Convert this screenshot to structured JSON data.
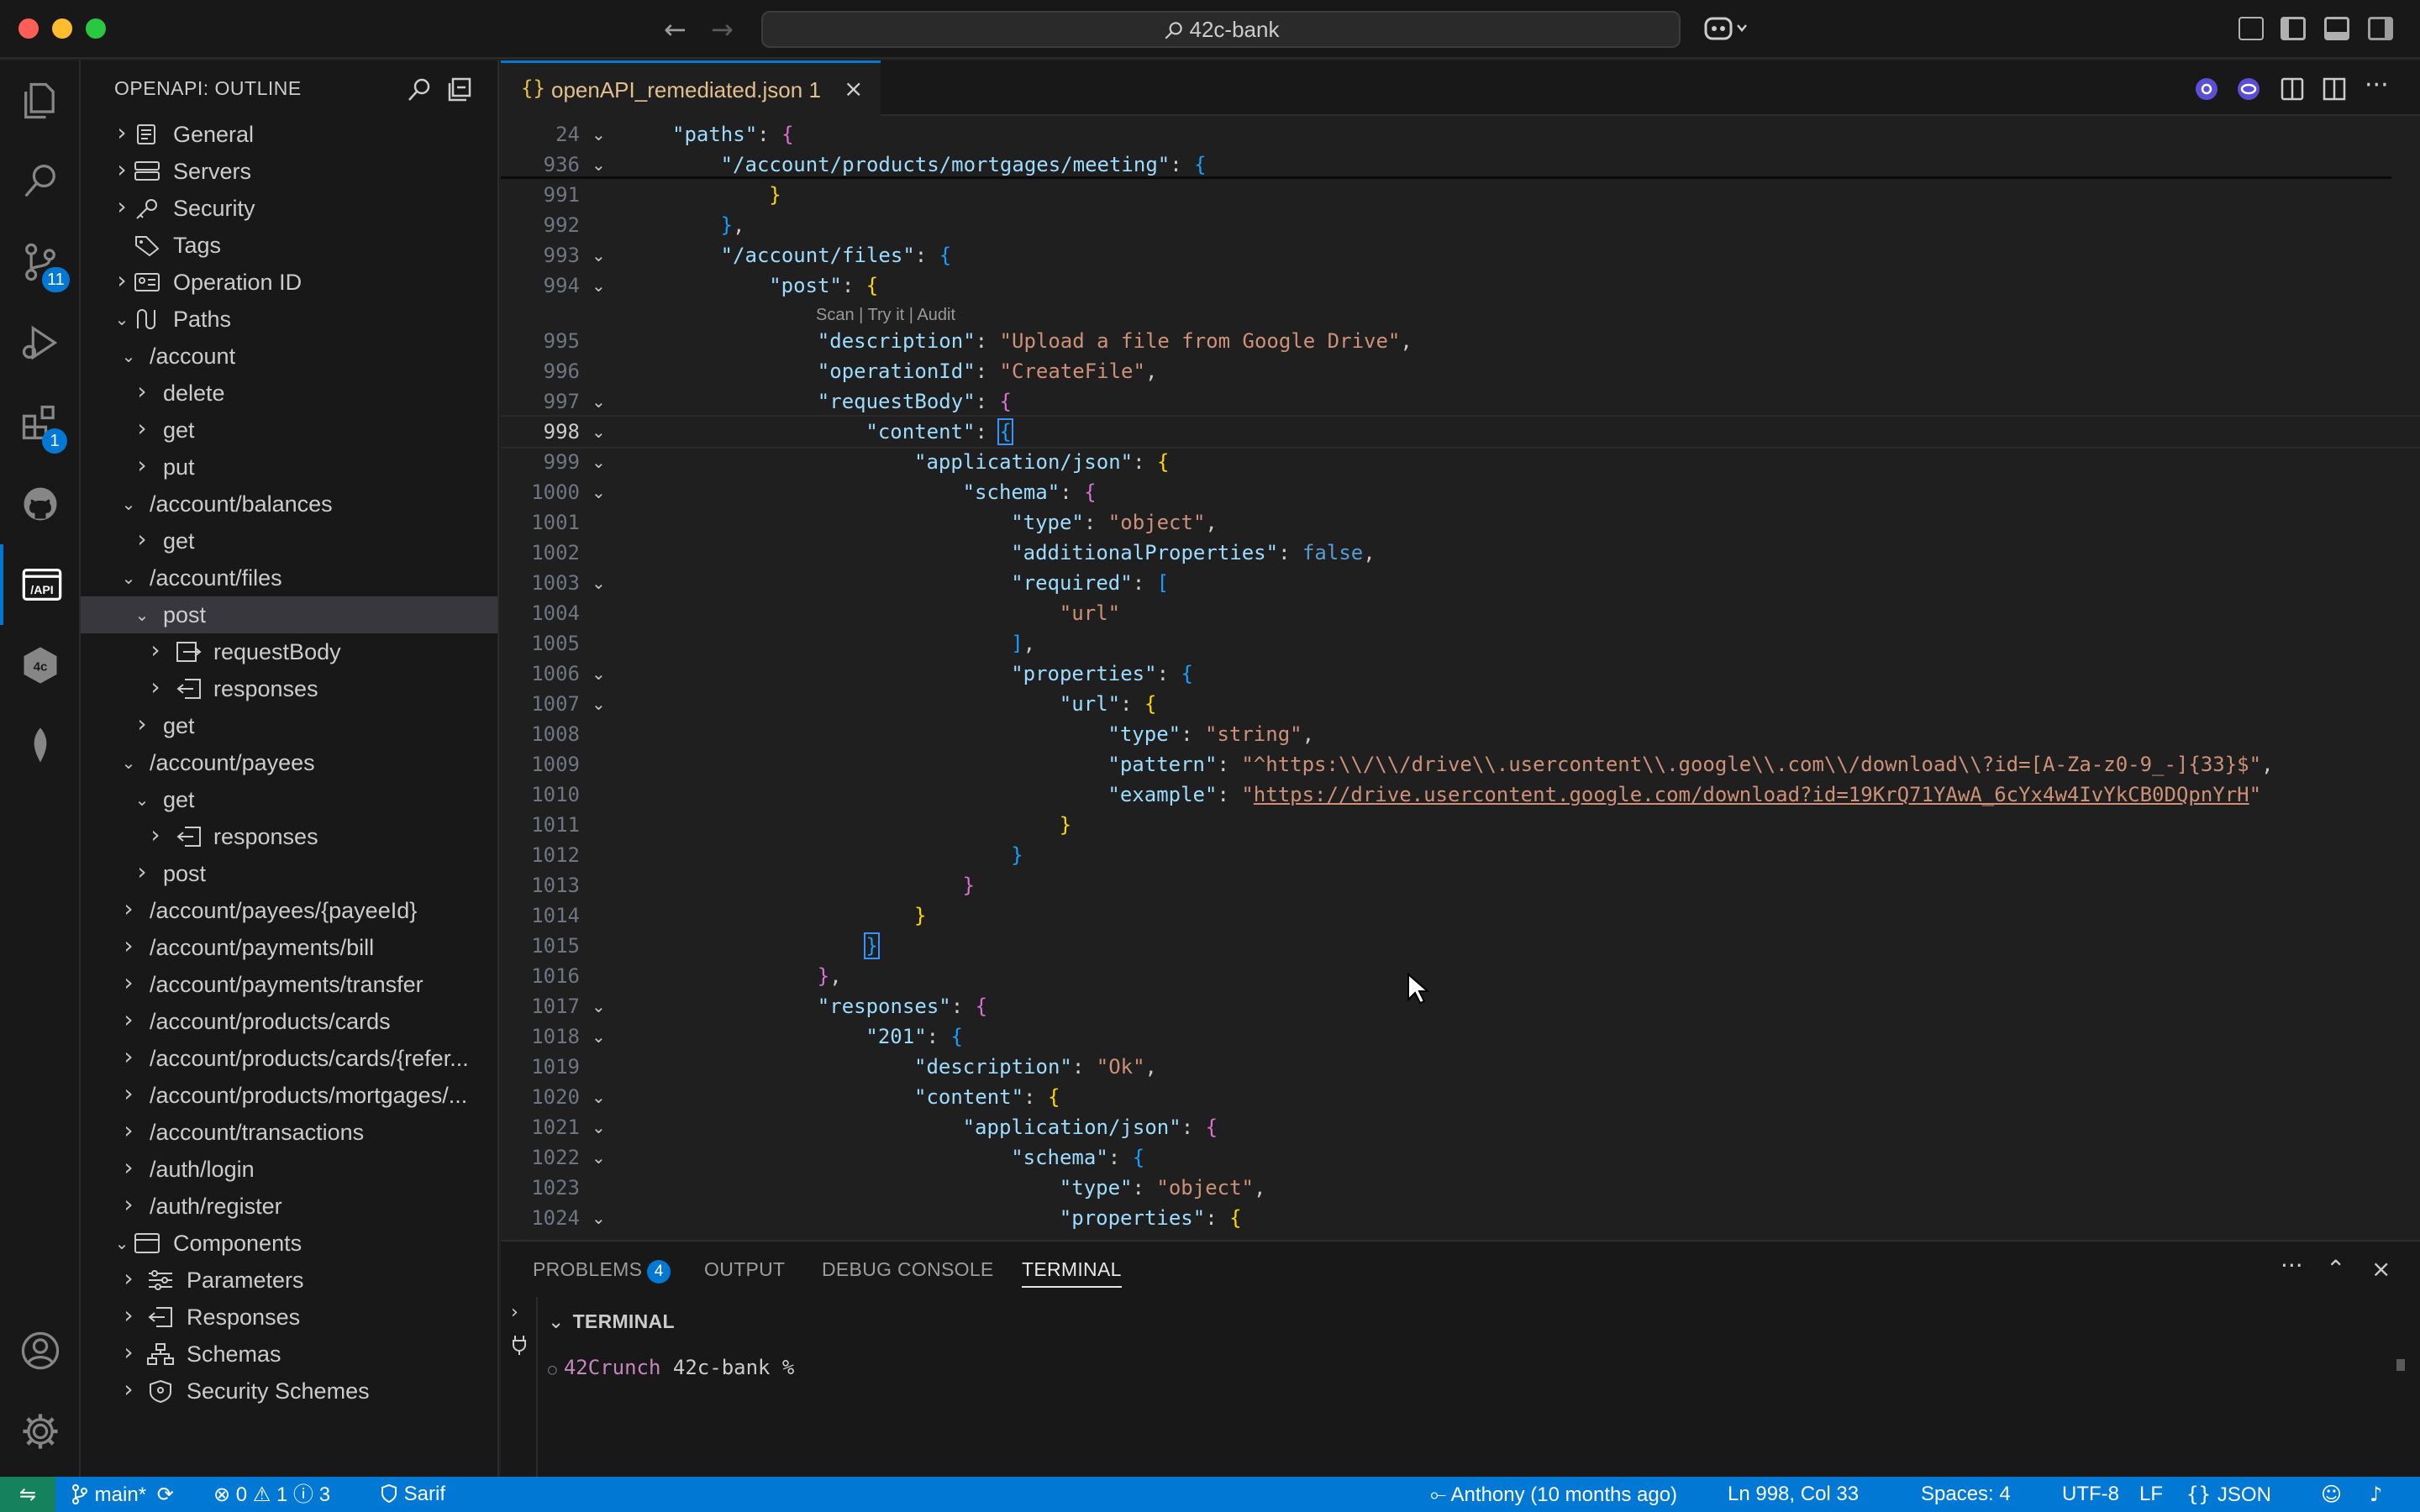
{
  "window": {
    "title": "42c-bank"
  },
  "sidebar": {
    "title": "OPENAPI: OUTLINE",
    "tree": [
      {
        "label": "General",
        "icon": "document-icon",
        "chevron": "right",
        "level": 0
      },
      {
        "label": "Servers",
        "icon": "server-icon",
        "chevron": "right",
        "level": 0
      },
      {
        "label": "Security",
        "icon": "key-icon",
        "chevron": "right",
        "level": 0
      },
      {
        "label": "Tags",
        "icon": "tag-icon",
        "chevron": "none",
        "level": 0
      },
      {
        "label": "Operation ID",
        "icon": "id-card-icon",
        "chevron": "right",
        "level": 0
      },
      {
        "label": "Paths",
        "icon": "paths-icon",
        "chevron": "down",
        "level": 0
      },
      {
        "label": "/account",
        "icon": "",
        "chevron": "down",
        "level": 1
      },
      {
        "label": "delete",
        "icon": "",
        "chevron": "right",
        "level": 2
      },
      {
        "label": "get",
        "icon": "",
        "chevron": "right",
        "level": 2
      },
      {
        "label": "put",
        "icon": "",
        "chevron": "right",
        "level": 2
      },
      {
        "label": "/account/balances",
        "icon": "",
        "chevron": "down",
        "level": 1
      },
      {
        "label": "get",
        "icon": "",
        "chevron": "right",
        "level": 2
      },
      {
        "label": "/account/files",
        "icon": "",
        "chevron": "down",
        "level": 1
      },
      {
        "label": "post",
        "icon": "",
        "chevron": "down",
        "level": 2,
        "selected": true
      },
      {
        "label": "requestBody",
        "icon": "request-body-icon",
        "chevron": "right",
        "level": 3
      },
      {
        "label": "responses",
        "icon": "responses-icon",
        "chevron": "right",
        "level": 3
      },
      {
        "label": "get",
        "icon": "",
        "chevron": "right",
        "level": 2
      },
      {
        "label": "/account/payees",
        "icon": "",
        "chevron": "down",
        "level": 1
      },
      {
        "label": "get",
        "icon": "",
        "chevron": "down",
        "level": 2
      },
      {
        "label": "responses",
        "icon": "responses-icon",
        "chevron": "right",
        "level": 3
      },
      {
        "label": "post",
        "icon": "",
        "chevron": "right",
        "level": 2
      },
      {
        "label": "/account/payees/{payeeId}",
        "icon": "",
        "chevron": "right",
        "level": 1
      },
      {
        "label": "/account/payments/bill",
        "icon": "",
        "chevron": "right",
        "level": 1
      },
      {
        "label": "/account/payments/transfer",
        "icon": "",
        "chevron": "right",
        "level": 1
      },
      {
        "label": "/account/products/cards",
        "icon": "",
        "chevron": "right",
        "level": 1
      },
      {
        "label": "/account/products/cards/{refer...",
        "icon": "",
        "chevron": "right",
        "level": 1
      },
      {
        "label": "/account/products/mortgages/...",
        "icon": "",
        "chevron": "right",
        "level": 1
      },
      {
        "label": "/account/transactions",
        "icon": "",
        "chevron": "right",
        "level": 1
      },
      {
        "label": "/auth/login",
        "icon": "",
        "chevron": "right",
        "level": 1
      },
      {
        "label": "/auth/register",
        "icon": "",
        "chevron": "right",
        "level": 1
      },
      {
        "label": "Components",
        "icon": "package-icon",
        "chevron": "down",
        "level": 0
      },
      {
        "label": "Parameters",
        "icon": "sliders-icon",
        "chevron": "right",
        "level": 1
      },
      {
        "label": "Responses",
        "icon": "responses-icon",
        "chevron": "right",
        "level": 1
      },
      {
        "label": "Schemas",
        "icon": "hierarchy-icon",
        "chevron": "right",
        "level": 1
      },
      {
        "label": "Security Schemes",
        "icon": "shield-icon",
        "chevron": "right",
        "level": 1
      }
    ]
  },
  "activity": {
    "source_control_badge": "11",
    "extensions_badge": "1"
  },
  "editor": {
    "tab": {
      "icon": "{}",
      "label": "openAPI_remediated.json",
      "problems": "1"
    },
    "codelens": "Scan | Try it | Audit",
    "current_line": "998",
    "lines": [
      {
        "n": "24",
        "fold": true,
        "ind": 0,
        "tok": [
          [
            "k",
            "\"paths\""
          ],
          [
            "p",
            ": "
          ],
          [
            "b2",
            "{"
          ]
        ]
      },
      {
        "n": "936",
        "fold": true,
        "ind": 1,
        "tok": [
          [
            "k",
            "\"/account/products/mortgages/meeting\""
          ],
          [
            "p",
            ": "
          ],
          [
            "b3",
            "{"
          ]
        ]
      },
      {
        "n": "991",
        "fold": false,
        "ind": 2,
        "tok": [
          [
            "b1",
            "}"
          ]
        ]
      },
      {
        "n": "992",
        "fold": false,
        "ind": 1,
        "tok": [
          [
            "b3",
            "}"
          ],
          [
            "p",
            ","
          ]
        ]
      },
      {
        "n": "993",
        "fold": true,
        "ind": 1,
        "tok": [
          [
            "k",
            "\"/account/files\""
          ],
          [
            "p",
            ": "
          ],
          [
            "b3",
            "{"
          ]
        ]
      },
      {
        "n": "994",
        "fold": true,
        "ind": 2,
        "tok": [
          [
            "k",
            "\"post\""
          ],
          [
            "p",
            ": "
          ],
          [
            "b1",
            "{"
          ]
        ]
      },
      {
        "n": "995",
        "fold": false,
        "ind": 3,
        "tok": [
          [
            "k",
            "\"description\""
          ],
          [
            "p",
            ": "
          ],
          [
            "s",
            "\"Upload a file from Google Drive\""
          ],
          [
            "p",
            ","
          ]
        ]
      },
      {
        "n": "996",
        "fold": false,
        "ind": 3,
        "tok": [
          [
            "k",
            "\"operationId\""
          ],
          [
            "p",
            ": "
          ],
          [
            "s",
            "\"CreateFile\""
          ],
          [
            "p",
            ","
          ]
        ]
      },
      {
        "n": "997",
        "fold": true,
        "ind": 3,
        "tok": [
          [
            "k",
            "\"requestBody\""
          ],
          [
            "p",
            ": "
          ],
          [
            "b2",
            "{"
          ]
        ]
      },
      {
        "n": "998",
        "fold": true,
        "ind": 4,
        "tok": [
          [
            "k",
            "\"content\""
          ],
          [
            "p",
            ": "
          ],
          [
            "b3m",
            "{"
          ]
        ]
      },
      {
        "n": "999",
        "fold": true,
        "ind": 5,
        "tok": [
          [
            "k",
            "\"application/json\""
          ],
          [
            "p",
            ": "
          ],
          [
            "b1",
            "{"
          ]
        ]
      },
      {
        "n": "1000",
        "fold": true,
        "ind": 6,
        "tok": [
          [
            "k",
            "\"schema\""
          ],
          [
            "p",
            ": "
          ],
          [
            "b2",
            "{"
          ]
        ]
      },
      {
        "n": "1001",
        "fold": false,
        "ind": 7,
        "tok": [
          [
            "k",
            "\"type\""
          ],
          [
            "p",
            ": "
          ],
          [
            "s",
            "\"object\""
          ],
          [
            "p",
            ","
          ]
        ]
      },
      {
        "n": "1002",
        "fold": false,
        "ind": 7,
        "tok": [
          [
            "k",
            "\"additionalProperties\""
          ],
          [
            "p",
            ": "
          ],
          [
            "kw",
            "false"
          ],
          [
            "p",
            ","
          ]
        ]
      },
      {
        "n": "1003",
        "fold": true,
        "ind": 7,
        "tok": [
          [
            "k",
            "\"required\""
          ],
          [
            "p",
            ": "
          ],
          [
            "b3",
            "["
          ]
        ]
      },
      {
        "n": "1004",
        "fold": false,
        "ind": 8,
        "tok": [
          [
            "s",
            "\"url\""
          ]
        ]
      },
      {
        "n": "1005",
        "fold": false,
        "ind": 7,
        "tok": [
          [
            "b3",
            "]"
          ],
          [
            "p",
            ","
          ]
        ]
      },
      {
        "n": "1006",
        "fold": true,
        "ind": 7,
        "tok": [
          [
            "k",
            "\"properties\""
          ],
          [
            "p",
            ": "
          ],
          [
            "b3",
            "{"
          ]
        ]
      },
      {
        "n": "1007",
        "fold": true,
        "ind": 8,
        "tok": [
          [
            "k",
            "\"url\""
          ],
          [
            "p",
            ": "
          ],
          [
            "b1",
            "{"
          ]
        ]
      },
      {
        "n": "1008",
        "fold": false,
        "ind": 9,
        "tok": [
          [
            "k",
            "\"type\""
          ],
          [
            "p",
            ": "
          ],
          [
            "s",
            "\"string\""
          ],
          [
            "p",
            ","
          ]
        ]
      },
      {
        "n": "1009",
        "fold": false,
        "ind": 9,
        "tok": [
          [
            "k",
            "\"pattern\""
          ],
          [
            "p",
            ": "
          ],
          [
            "s",
            "\"^https:\\\\/\\\\/drive\\\\.usercontent\\\\.google\\\\.com\\\\/download\\\\?id=[A-Za-z0-9_-]{33}$\""
          ],
          [
            "p",
            ","
          ]
        ]
      },
      {
        "n": "1010",
        "fold": false,
        "ind": 9,
        "tok": [
          [
            "k",
            "\"example\""
          ],
          [
            "p",
            ": "
          ],
          [
            "s",
            "\""
          ],
          [
            "u",
            "https://drive.usercontent.google.com/download?id=19KrQ71YAwA_6cYx4w4IvYkCB0DQpnYrH"
          ],
          [
            "s",
            "\""
          ]
        ]
      },
      {
        "n": "1011",
        "fold": false,
        "ind": 8,
        "tok": [
          [
            "b1",
            "}"
          ]
        ]
      },
      {
        "n": "1012",
        "fold": false,
        "ind": 7,
        "tok": [
          [
            "b3",
            "}"
          ]
        ]
      },
      {
        "n": "1013",
        "fold": false,
        "ind": 6,
        "tok": [
          [
            "b2",
            "}"
          ]
        ]
      },
      {
        "n": "1014",
        "fold": false,
        "ind": 5,
        "tok": [
          [
            "b1",
            "}"
          ]
        ]
      },
      {
        "n": "1015",
        "fold": false,
        "ind": 4,
        "tok": [
          [
            "b3m",
            "}"
          ]
        ]
      },
      {
        "n": "1016",
        "fold": false,
        "ind": 3,
        "tok": [
          [
            "b2",
            "}"
          ],
          [
            "p",
            ","
          ]
        ]
      },
      {
        "n": "1017",
        "fold": true,
        "ind": 3,
        "tok": [
          [
            "k",
            "\"responses\""
          ],
          [
            "p",
            ": "
          ],
          [
            "b2",
            "{"
          ]
        ]
      },
      {
        "n": "1018",
        "fold": true,
        "ind": 4,
        "tok": [
          [
            "k",
            "\"201\""
          ],
          [
            "p",
            ": "
          ],
          [
            "b3",
            "{"
          ]
        ]
      },
      {
        "n": "1019",
        "fold": false,
        "ind": 5,
        "tok": [
          [
            "k",
            "\"description\""
          ],
          [
            "p",
            ": "
          ],
          [
            "s",
            "\"Ok\""
          ],
          [
            "p",
            ","
          ]
        ]
      },
      {
        "n": "1020",
        "fold": true,
        "ind": 5,
        "tok": [
          [
            "k",
            "\"content\""
          ],
          [
            "p",
            ": "
          ],
          [
            "b1",
            "{"
          ]
        ]
      },
      {
        "n": "1021",
        "fold": true,
        "ind": 6,
        "tok": [
          [
            "k",
            "\"application/json\""
          ],
          [
            "p",
            ": "
          ],
          [
            "b2",
            "{"
          ]
        ]
      },
      {
        "n": "1022",
        "fold": true,
        "ind": 7,
        "tok": [
          [
            "k",
            "\"schema\""
          ],
          [
            "p",
            ": "
          ],
          [
            "b3",
            "{"
          ]
        ]
      },
      {
        "n": "1023",
        "fold": false,
        "ind": 8,
        "tok": [
          [
            "k",
            "\"type\""
          ],
          [
            "p",
            ": "
          ],
          [
            "s",
            "\"object\""
          ],
          [
            "p",
            ","
          ]
        ]
      },
      {
        "n": "1024",
        "fold": true,
        "ind": 8,
        "tok": [
          [
            "k",
            "\"properties\""
          ],
          [
            "p",
            ": "
          ],
          [
            "b1",
            "{"
          ]
        ]
      }
    ]
  },
  "panel": {
    "tabs": {
      "problems": "PROBLEMS",
      "problems_count": "4",
      "output": "OUTPUT",
      "debug_console": "DEBUG CONSOLE",
      "terminal": "TERMINAL"
    },
    "terminal_header": "TERMINAL",
    "terminal_user": "42Crunch",
    "terminal_cwd": "42c-bank %"
  },
  "status": {
    "branch": "main*",
    "errors": "0",
    "warnings": "1",
    "infos": "3",
    "sarif": "Sarif",
    "blame": "Anthony (10 months ago)",
    "position": "Ln 998, Col 33",
    "spaces": "Spaces: 4",
    "encoding": "UTF-8",
    "eol": "LF",
    "language": "JSON"
  },
  "colors": {
    "accent": "#0078d4",
    "string": "#ce9178",
    "key": "#9cdcfe",
    "bracket_gold": "#ffd700",
    "bracket_purple": "#da70d6",
    "bracket_blue": "#179fff"
  }
}
